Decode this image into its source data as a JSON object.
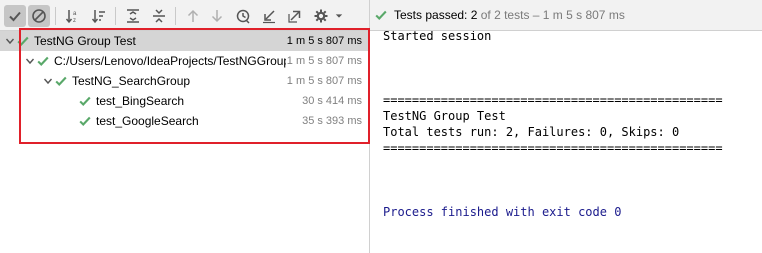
{
  "toolbar": {
    "buttons": [
      {
        "name": "show-passed",
        "icon": "check-icon",
        "active": true
      },
      {
        "name": "show-ignored",
        "icon": "no-entry-icon",
        "active": true
      },
      {
        "name": "sort-alphabetically",
        "icon": "sort-alpha-icon"
      },
      {
        "name": "sort-by-duration",
        "icon": "sort-duration-icon"
      },
      {
        "name": "expand-all",
        "icon": "expand-all-icon"
      },
      {
        "name": "collapse-all",
        "icon": "collapse-all-icon"
      },
      {
        "name": "previous-failed",
        "icon": "arrow-up-icon"
      },
      {
        "name": "next-failed",
        "icon": "arrow-down-icon"
      },
      {
        "name": "test-history",
        "icon": "history-icon"
      },
      {
        "name": "import-tests",
        "icon": "import-icon"
      },
      {
        "name": "export-tests",
        "icon": "export-icon"
      },
      {
        "name": "settings",
        "icon": "gear-icon"
      }
    ]
  },
  "status": {
    "label": "Tests passed:",
    "count": "2",
    "detail": "of 2 tests – 1 m 5 s 807 ms"
  },
  "tree": {
    "rows": [
      {
        "name": "TestNG Group Test",
        "time": "1 m 5 s 807 ms",
        "selected": true
      },
      {
        "name": "C:/Users/Lenovo/IdeaProjects/TestNGGroup",
        "time": "1 m 5 s 807 ms"
      },
      {
        "name": "TestNG_SearchGroup",
        "time": "1 m 5 s 807 ms"
      },
      {
        "name": "test_BingSearch",
        "time": "30 s 414 ms"
      },
      {
        "name": "test_GoogleSearch",
        "time": "35 s 393 ms"
      }
    ]
  },
  "console": {
    "lines": [
      "Started session",
      "",
      "",
      "",
      "===============================================",
      "TestNG Group Test",
      "Total tests run: 2, Failures: 0, Skips: 0",
      "===============================================",
      "",
      "",
      "",
      "Process finished with exit code 0"
    ]
  },
  "colors": {
    "pass_green": "#59a869",
    "highlight_red": "#e0202a",
    "exit_text": "#1a1a8c"
  }
}
